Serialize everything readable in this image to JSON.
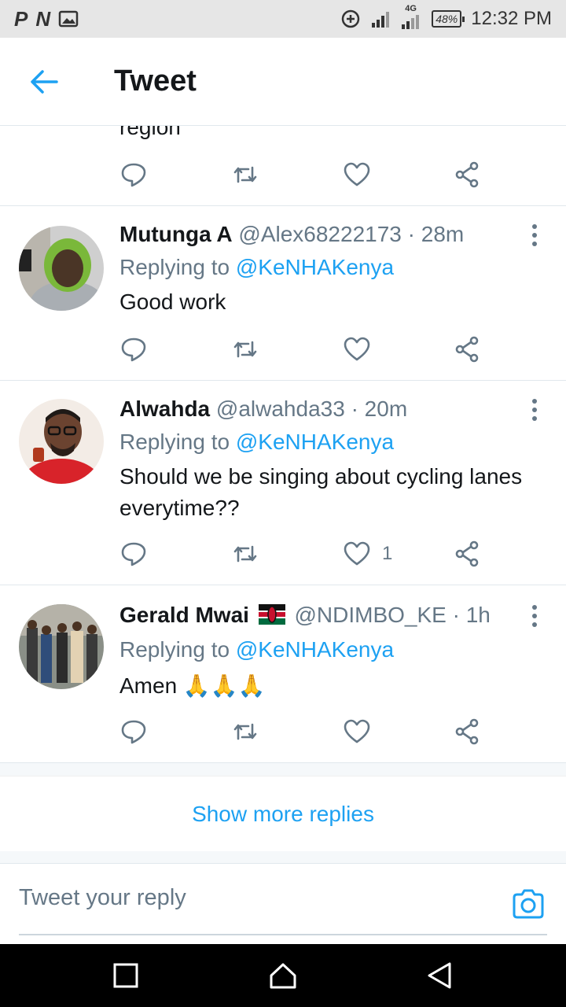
{
  "status_bar": {
    "left_icons": [
      "P",
      "N",
      "image-icon"
    ],
    "network": "4G",
    "battery": "48%",
    "time": "12:32 PM"
  },
  "header": {
    "title": "Tweet"
  },
  "partial_tweet": {
    "text": "region"
  },
  "replies": [
    {
      "name": "Mutunga A",
      "handle": "@Alex68222173 · 28m",
      "replying_prefix": "Replying to ",
      "replying_to": "@KeNHAKenya",
      "text": "Good work",
      "like_count": ""
    },
    {
      "name": "Alwahda",
      "handle": "@alwahda33 · 20m",
      "replying_prefix": "Replying to ",
      "replying_to": "@KeNHAKenya",
      "text": "Should we be singing about cycling lanes everytime??",
      "like_count": "1"
    },
    {
      "name": "Gerald Mwai",
      "handle": "@NDIMBO_KE · 1h",
      "replying_prefix": "Replying to ",
      "replying_to": "@KeNHAKenya",
      "text": "Amen 🙏🙏🙏",
      "like_count": ""
    }
  ],
  "show_more": "Show more replies",
  "reply_bar": {
    "placeholder": "Tweet your reply"
  },
  "colors": {
    "accent": "#1da1f2",
    "secondary_text": "#657786",
    "divider": "#e1e8ed"
  }
}
